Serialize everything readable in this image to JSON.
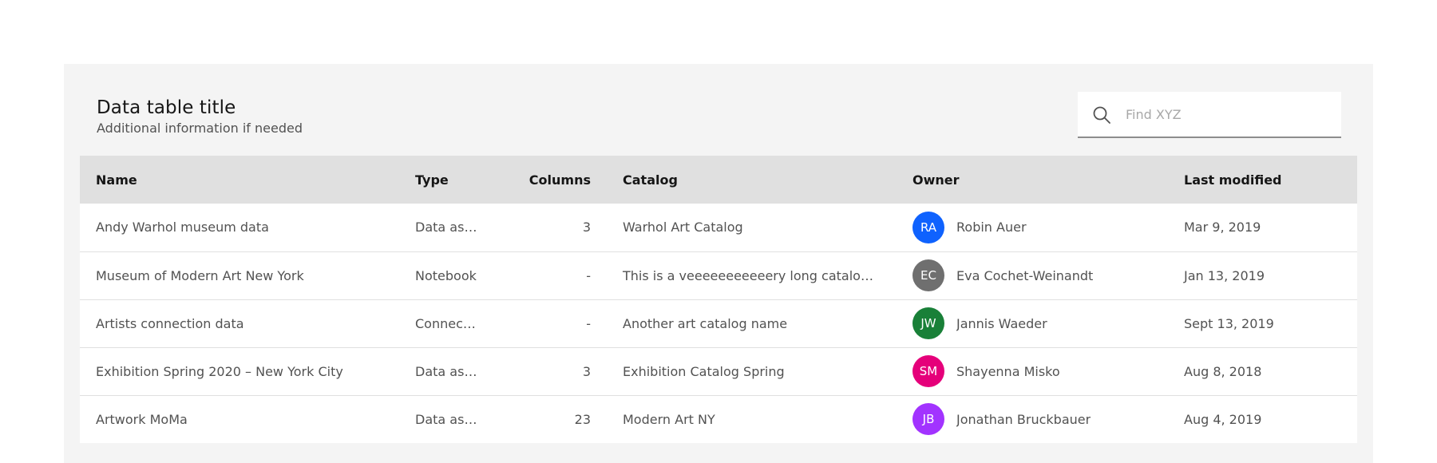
{
  "header": {
    "title": "Data table title",
    "subtitle": "Additional information if needed"
  },
  "search": {
    "placeholder": "Find XYZ",
    "value": "",
    "icon": "search-icon"
  },
  "table": {
    "columns": [
      "Name",
      "Type",
      "Columns",
      "Catalog",
      "Owner",
      "Last modified"
    ],
    "rows": [
      {
        "name": "Andy Warhol museum data",
        "type": "Data asset",
        "columns": "3",
        "catalog": "Warhol Art Catalog",
        "owner": {
          "initials": "RA",
          "name": "Robin Auer",
          "color": "#0f62fe"
        },
        "modified": "Mar 9, 2019"
      },
      {
        "name": "Museum of Modern Art New York",
        "type": "Notebook",
        "columns": "-",
        "catalog": "This is a veeeeeeeeeeery long catalog name",
        "owner": {
          "initials": "EC",
          "name": "Eva Cochet-Weinandt",
          "color": "#6f6f6f"
        },
        "modified": "Jan 13, 2019"
      },
      {
        "name": "Artists connection data",
        "type": "Connection",
        "columns": "-",
        "catalog": "Another art catalog name",
        "owner": {
          "initials": "JW",
          "name": "Jannis Waeder",
          "color": "#198038"
        },
        "modified": "Sept 13, 2019"
      },
      {
        "name": "Exhibition Spring 2020 – New York City",
        "type": "Data asset",
        "columns": "3",
        "catalog": "Exhibition Catalog Spring",
        "owner": {
          "initials": "SM",
          "name": "Shayenna Misko",
          "color": "#e5007a"
        },
        "modified": "Aug 8, 2018"
      },
      {
        "name": "Artwork MoMa",
        "type": "Data asset",
        "columns": "23",
        "catalog": "Modern Art NY",
        "owner": {
          "initials": "JB",
          "name": "Jonathan Bruckbauer",
          "color": "#a233ff"
        },
        "modified": "Aug 4, 2019"
      }
    ]
  }
}
